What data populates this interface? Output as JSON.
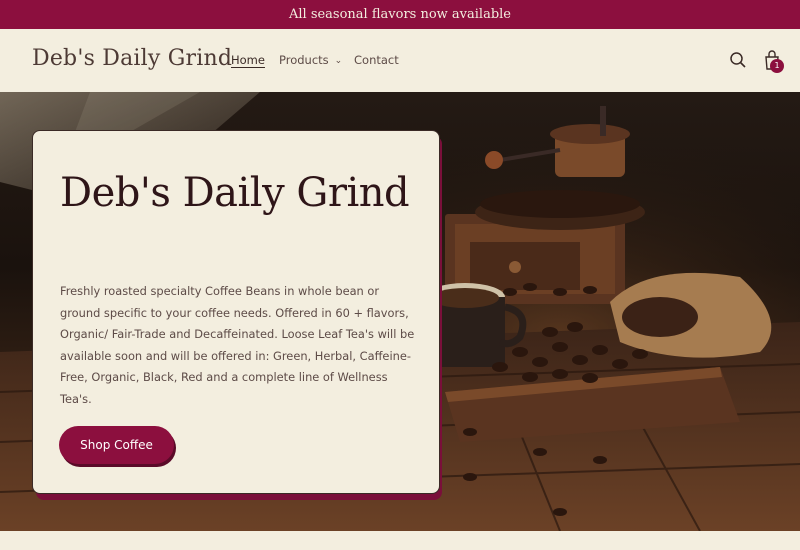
{
  "announcement": {
    "text": "All seasonal flavors now available"
  },
  "header": {
    "logo": "Deb's Daily Grind",
    "nav": [
      {
        "label": "Home"
      },
      {
        "label": "Products"
      },
      {
        "label": "Contact"
      }
    ],
    "cart_count": "1"
  },
  "hero": {
    "title": "Deb's Daily Grind",
    "body": "Freshly roasted specialty Coffee Beans in whole bean or ground specific to your coffee needs. Offered in 60 + flavors, Organic/ Fair-Trade and Decaffeinated. Loose Leaf Tea's will be available soon and will be offered in: Green, Herbal, Caffeine-Free, Organic, Black, Red and a complete line of Wellness Tea's.",
    "button_label": "Shop Coffee"
  },
  "colors": {
    "accent": "#8c0f3e",
    "background": "#f3eedf",
    "text": "#5d4b47"
  },
  "icons": [
    "search-icon",
    "cart-icon",
    "chevron-down-icon"
  ]
}
